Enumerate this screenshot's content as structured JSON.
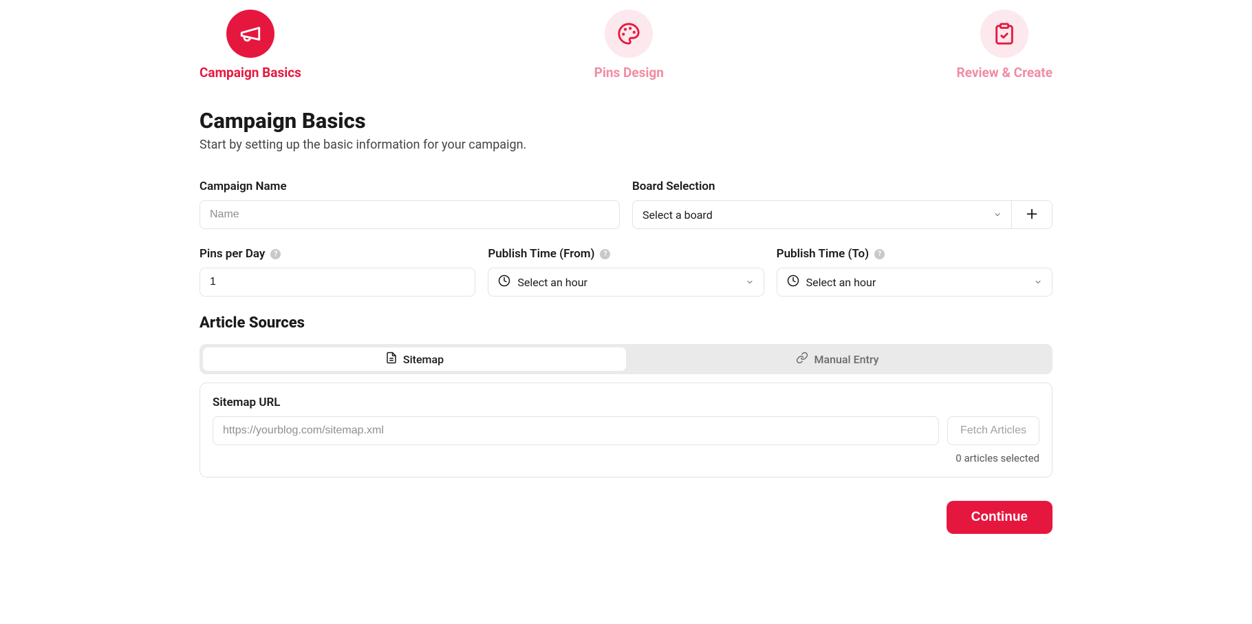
{
  "steps": {
    "s1": "Campaign Basics",
    "s2": "Pins Design",
    "s3": "Review & Create"
  },
  "header": {
    "title": "Campaign Basics",
    "subtitle": "Start by setting up the basic information for your campaign."
  },
  "fields": {
    "campaign_name": {
      "label": "Campaign Name",
      "placeholder": "Name",
      "value": ""
    },
    "board": {
      "label": "Board Selection",
      "placeholder": "Select a board"
    },
    "pins_per_day": {
      "label": "Pins per Day",
      "value": "1"
    },
    "publish_from": {
      "label": "Publish Time (From)",
      "placeholder": "Select an hour"
    },
    "publish_to": {
      "label": "Publish Time (To)",
      "placeholder": "Select an hour"
    }
  },
  "article_sources": {
    "heading": "Article Sources",
    "tabs": {
      "sitemap": "Sitemap",
      "manual": "Manual Entry"
    },
    "sitemap": {
      "label": "Sitemap URL",
      "placeholder": "https://yourblog.com/sitemap.xml",
      "value": "",
      "fetch_label": "Fetch Articles",
      "selected_text": "0 articles selected"
    }
  },
  "footer": {
    "continue": "Continue"
  }
}
